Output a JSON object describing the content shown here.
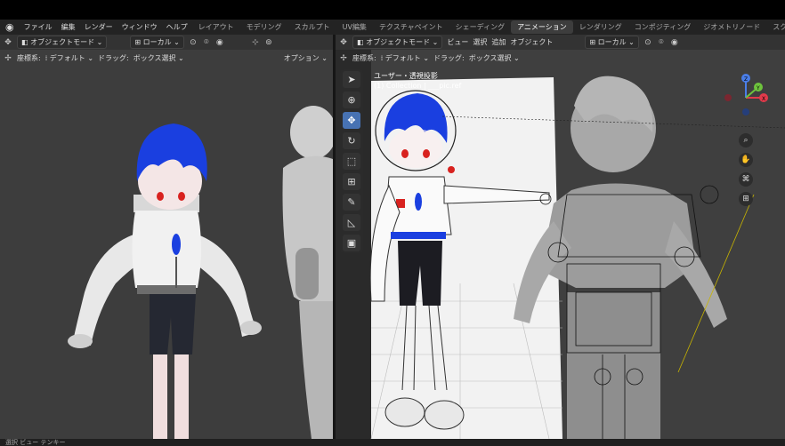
{
  "menubar": {
    "menus": [
      "ファイル",
      "編集",
      "レンダー",
      "ウィンドウ",
      "ヘルプ"
    ],
    "workspaces": [
      "レイアウト",
      "モデリング",
      "スカルプト",
      "UV編集",
      "テクスチャペイント",
      "シェーディング",
      "アニメーション",
      "レンダリング",
      "コンポジティング",
      "ジオメトリノード",
      "スクリプト作成"
    ],
    "active_workspace": "アニメーション"
  },
  "left_viewport": {
    "mode_label": "オブジェクトモード",
    "transform_orientation": "ローカル",
    "orientation_label": "座標系:",
    "orientation_value": "デフォルト",
    "drag_label": "ドラッグ:",
    "drag_value": "ボックス選択",
    "options_label": "オプション"
  },
  "right_viewport": {
    "mode_label": "オブジェクトモード",
    "menus": [
      "ビュー",
      "選択",
      "追加",
      "オブジェクト"
    ],
    "transform_orientation": "ローカル",
    "orientation_label": "座標系:",
    "orientation_value": "デフォルト",
    "drag_label": "ドラッグ:",
    "drag_value": "ボックス選択",
    "view_title": "ユーザー・透視投影",
    "view_subtitle": "(1) Collection | ___pic.ref",
    "gizmo_axes": [
      "X",
      "Y",
      "Z"
    ]
  },
  "statusbar": {
    "text": "選択     ビュー     テンキー"
  },
  "colors": {
    "accent": "#4772b3",
    "hair_blue": "#1a3fe0",
    "bg_viewport": "#3f3f3f"
  }
}
